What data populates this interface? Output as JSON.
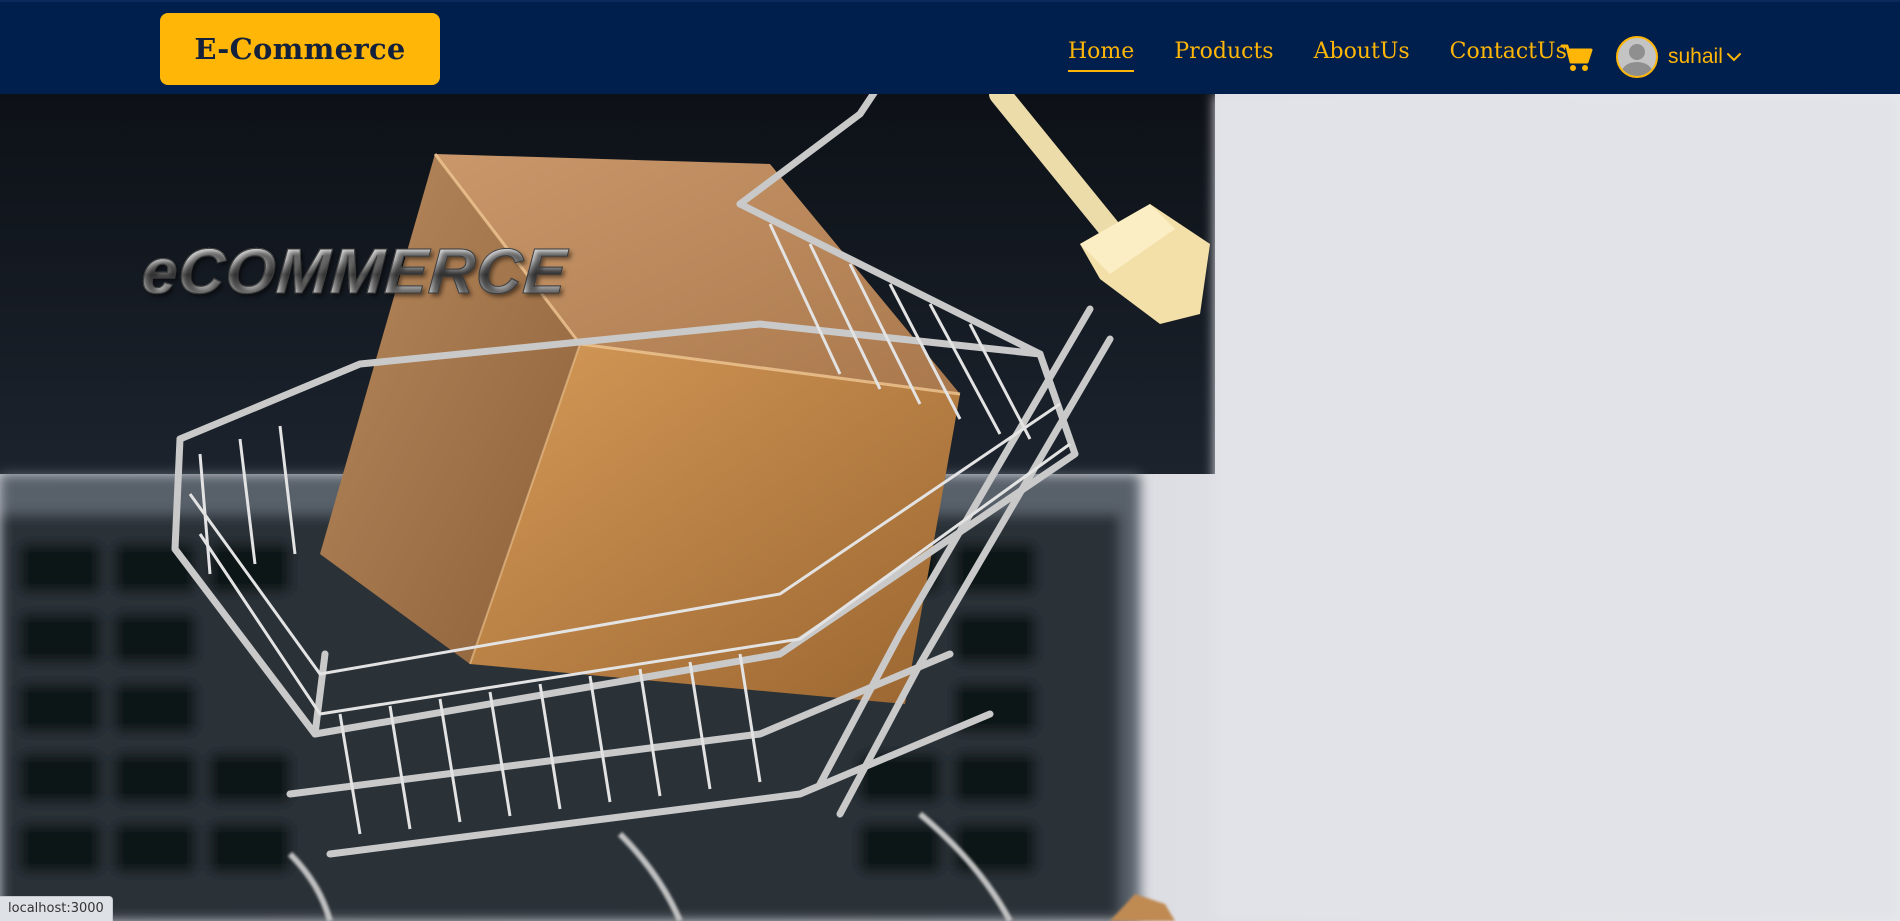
{
  "brand": {
    "label": "E-Commerce"
  },
  "nav": {
    "items": [
      {
        "label": "Home",
        "active": true
      },
      {
        "label": "Products",
        "active": false
      },
      {
        "label": "AboutUs",
        "active": false
      },
      {
        "label": "ContactUs",
        "active": false
      }
    ]
  },
  "cart": {
    "icon": "cart-icon"
  },
  "user": {
    "name": "suhail",
    "avatar_icon": "user-avatar-icon",
    "dropdown_icon": "chevron-down-icon"
  },
  "hero": {
    "title": "eCOMMERCE"
  },
  "status_bar": {
    "url": "localhost:3000"
  },
  "colors": {
    "navbar_bg": "#001f4d",
    "accent": "#ffb606"
  }
}
